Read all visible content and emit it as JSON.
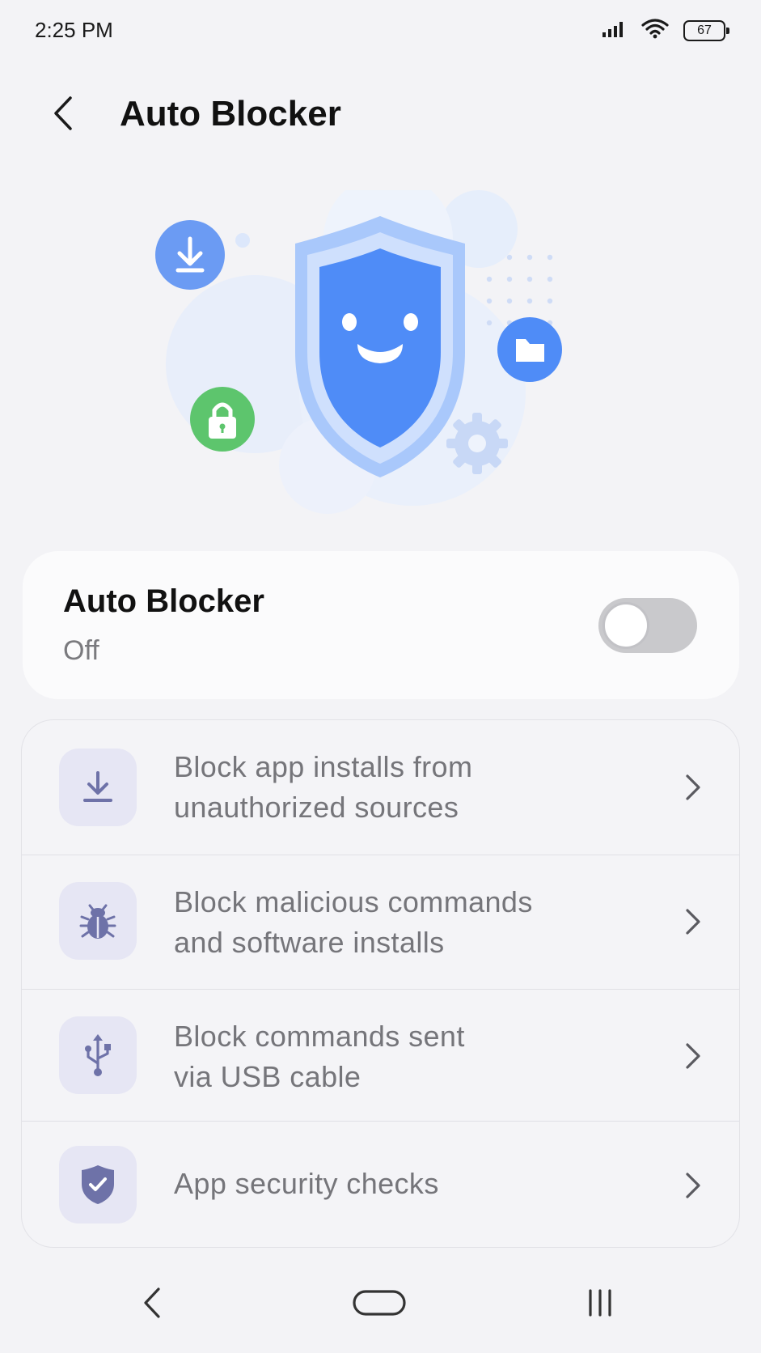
{
  "status_bar": {
    "time": "2:25 PM",
    "battery_level": "67",
    "icons": [
      "signal-icon",
      "wifi-icon",
      "battery-icon"
    ]
  },
  "header": {
    "title": "Auto Blocker",
    "back_icon": "back-arrow-icon"
  },
  "illustration": {
    "icons": [
      "shield-smile-icon",
      "download-icon",
      "lock-icon",
      "folder-icon",
      "gear-icon"
    ]
  },
  "toggle": {
    "title": "Auto Blocker",
    "state": "Off",
    "enabled": false
  },
  "items": [
    {
      "label": "Block app installs from\nunauthorized sources",
      "icon": "download-icon"
    },
    {
      "label": "Block malicious commands\nand software installs",
      "icon": "bug-icon"
    },
    {
      "label": "Block commands sent\nvia USB cable",
      "icon": "usb-icon"
    },
    {
      "label": "App security checks",
      "icon": "shield-check-icon"
    }
  ],
  "nav": {
    "buttons": [
      "nav-back-icon",
      "nav-home-icon",
      "nav-recents-icon"
    ]
  },
  "colors": {
    "accent_blue": "#4f8cf7",
    "light_blue": "#9ec2fb",
    "green": "#5dc56d",
    "icon_tile": "#e6e6f4",
    "icon_color": "#6e72a8",
    "background": "#f3f3f6"
  }
}
